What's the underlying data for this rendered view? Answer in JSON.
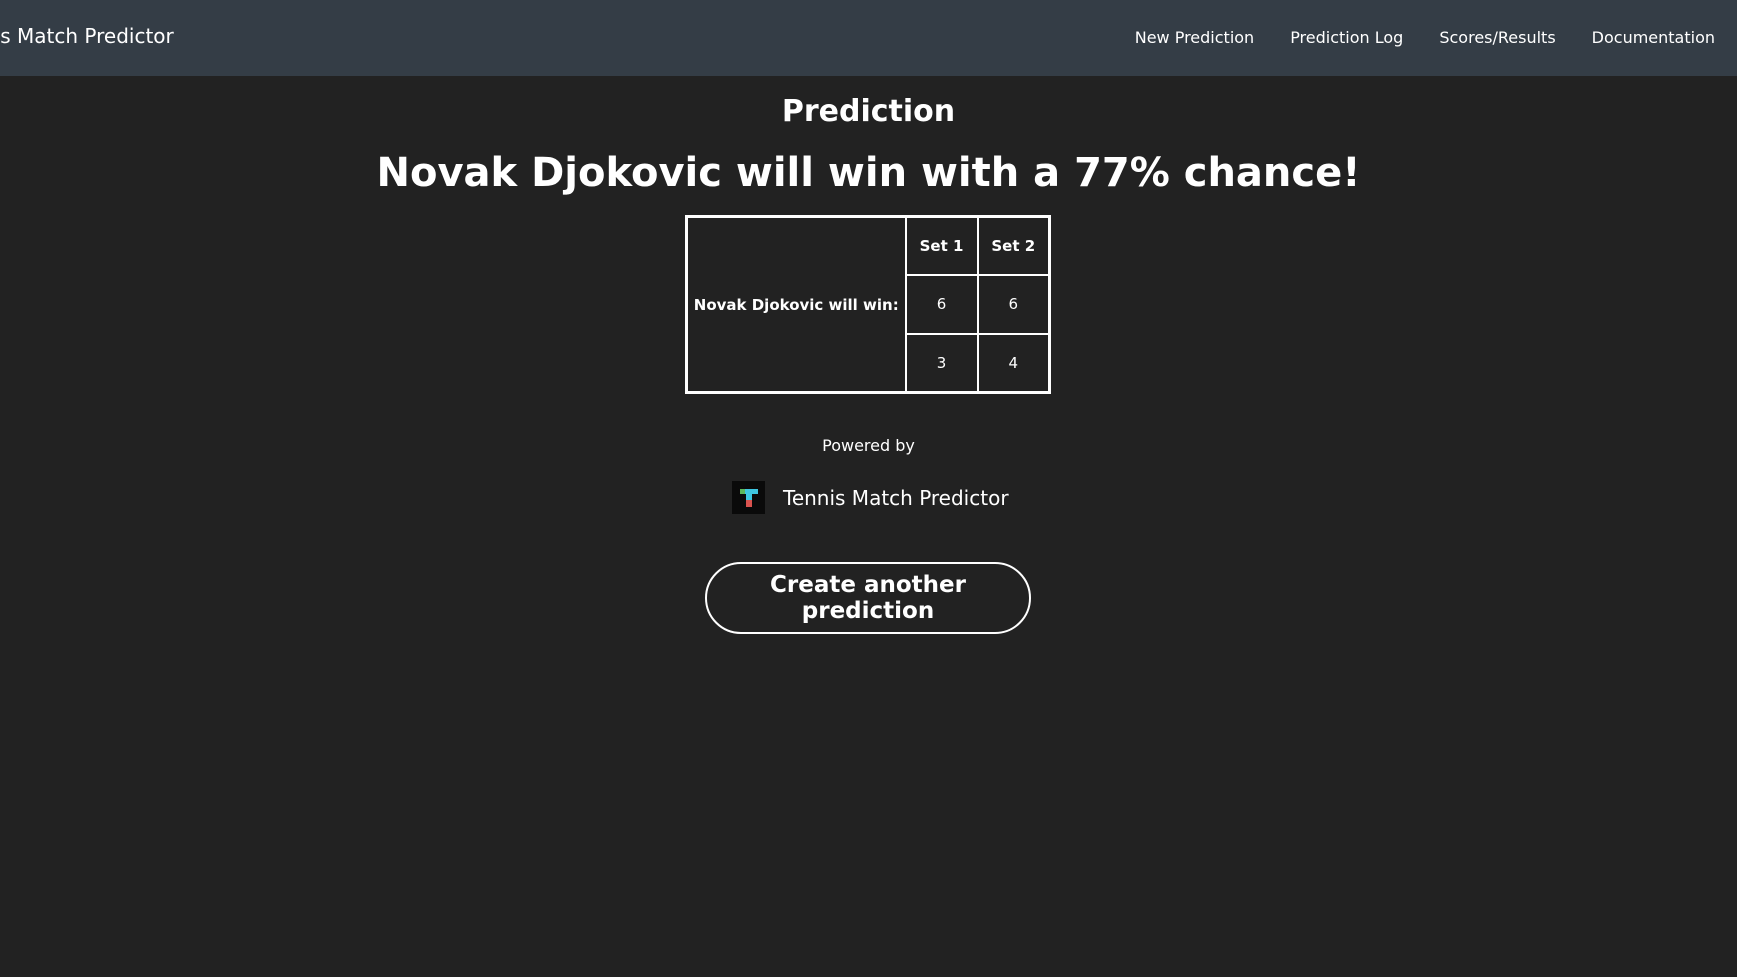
{
  "navbar": {
    "brand": "nis Match Predictor",
    "links": [
      "New Prediction",
      "Prediction Log",
      "Scores/Results",
      "Documentation"
    ]
  },
  "main": {
    "title": "Prediction",
    "headline": "Novak Djokovic will win with a 77% chance!"
  },
  "score_table": {
    "player_label": "Novak Djokovic will win:",
    "headers": [
      "Set 1",
      "Set 2"
    ],
    "rows": [
      [
        "6",
        "6"
      ],
      [
        "3",
        "4"
      ]
    ]
  },
  "footer": {
    "powered_by": "Powered by",
    "logo_letter": "T",
    "name": "Tennis Match Predictor"
  },
  "cta": {
    "label": "Create another prediction"
  },
  "colors": {
    "background": "#222222",
    "navbar": "#343d46",
    "text": "#ffffff"
  }
}
